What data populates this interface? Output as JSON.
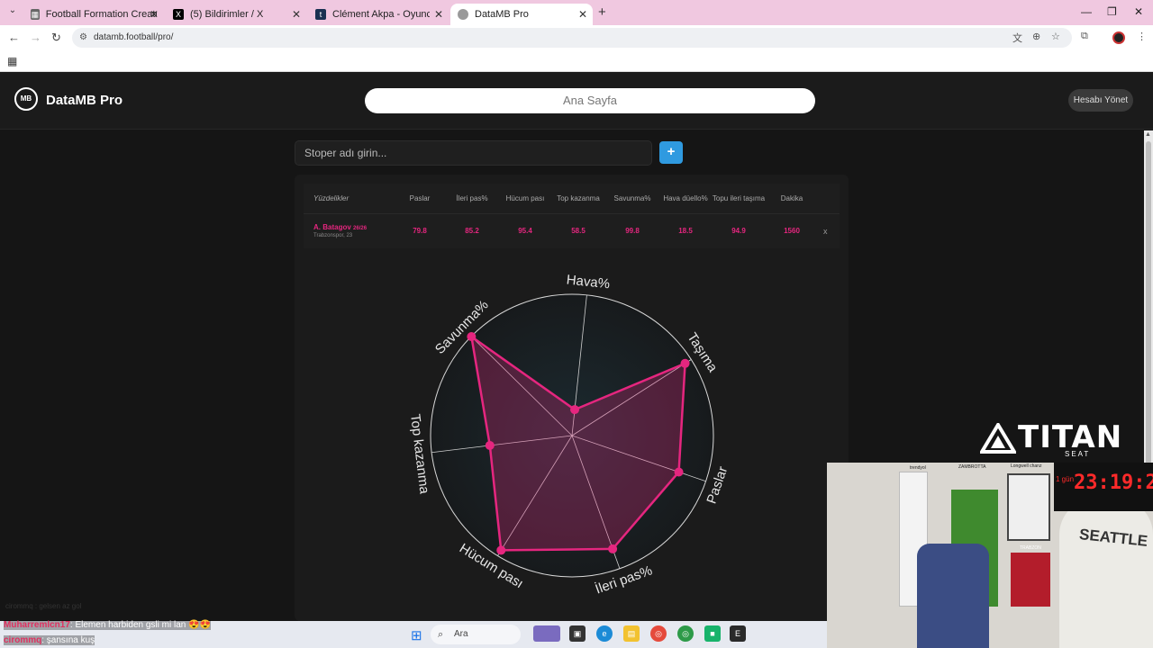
{
  "browser": {
    "tabs": [
      {
        "title": "Football Formation Creator: Re",
        "favicon": "grid-icon"
      },
      {
        "title": "(5) Bildirimler / X",
        "favicon": "x-icon"
      },
      {
        "title": "Clément Akpa - Oyuncu profili",
        "favicon": "tm-icon"
      },
      {
        "title": "DataMB Pro",
        "favicon": "datamb-icon",
        "active": true
      }
    ],
    "url": "datamb.football/pro/"
  },
  "app": {
    "logo_mark": "MB",
    "logo_text": "DataMB Pro",
    "home_label": "Ana Sayfa",
    "account_label": "Hesabı Yönet"
  },
  "search": {
    "placeholder": "Stoper adı girin...",
    "add_label": "+"
  },
  "table": {
    "headers": [
      "Yüzdelikler",
      "Paslar",
      "İleri pas%",
      "Hücum pası",
      "Top kazanma",
      "Savunma%",
      "Hava düello%",
      "Topu ileri taşıma",
      "Dakika"
    ],
    "rows": [
      {
        "player": "A. Batagov",
        "badge": "26/26",
        "team": "Trabzonspor, 23",
        "values": [
          "79.8",
          "85.2",
          "95.4",
          "58.5",
          "99.8",
          "18.5",
          "94.9",
          "1560"
        ],
        "remove": "x"
      }
    ]
  },
  "chart_data": {
    "type": "radar",
    "axes": [
      "Hava%",
      "Taşıma",
      "Paslar",
      "İleri pas%",
      "Hücum pası",
      "Top kazanma",
      "Savunma%"
    ],
    "series": [
      {
        "name": "A. Batagov",
        "values": [
          18.5,
          94.9,
          79.8,
          85.2,
          95.4,
          58.5,
          99.8
        ]
      }
    ],
    "rmax": 100,
    "color": "#e5267f"
  },
  "overlay": {
    "titan_word": "TITAN",
    "titan_sub": "SEAT",
    "clock": "23:19:2",
    "clock_day": "1 gün",
    "shirt_text": "SEATTLE",
    "labels": [
      "trendyol",
      "ZAMBROTTA",
      "Longwell chanz",
      "TRABZON"
    ],
    "chat": [
      {
        "user": "Muharremlcn17",
        "msg": ": Elemen harbiden gsli mi lan 😍😍"
      },
      {
        "user": "cirommq",
        "msg": ": şansına kuş"
      }
    ],
    "chat_ghost": "cirommq : gelsen az gol"
  },
  "taskbar": {
    "search_label": "Ara"
  }
}
